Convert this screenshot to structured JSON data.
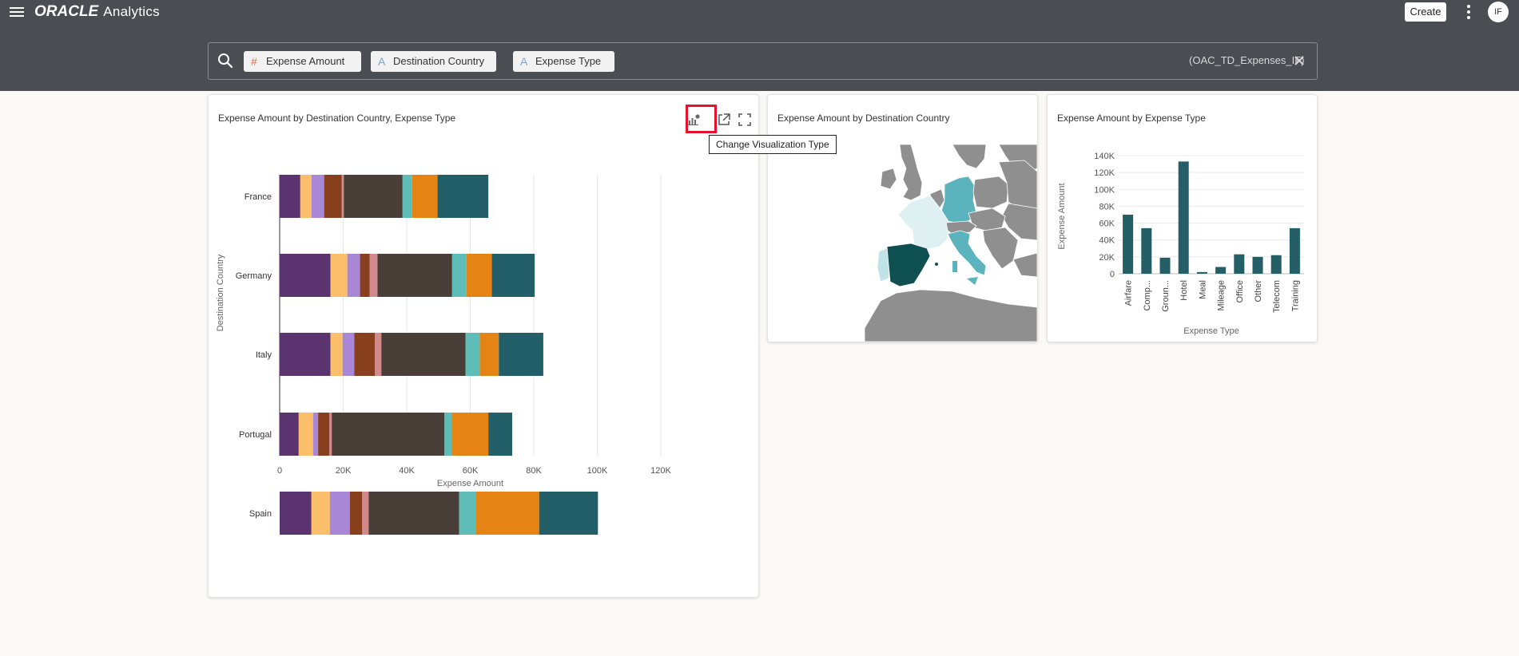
{
  "header": {
    "brand": "ORACLE",
    "product": "Analytics",
    "create_label": "Create",
    "avatar_initials": "IF"
  },
  "search": {
    "pills": [
      {
        "type_symbol": "#",
        "label": "Expense Amount"
      },
      {
        "type_symbol": "A",
        "label": "Destination Country"
      },
      {
        "type_symbol": "A",
        "label": "Expense Type"
      }
    ],
    "dataset": "(OAC_TD_Expenses_IF)"
  },
  "tooltip": "Change Visualization Type",
  "colors": {
    "header_bg": "#4a4e53",
    "highlight": "#e8112d",
    "map_teal_dark": "#0e4f52",
    "map_teal_mid": "#5bb3bd",
    "map_teal_light": "#dff0f3",
    "map_other": "#8f8f8f"
  },
  "chart_data": [
    {
      "type": "bar",
      "orientation": "horizontal",
      "stacked": true,
      "title": "Expense Amount by Destination Country, Expense Type",
      "xlabel": "Expense Amount",
      "ylabel": "Destination Country",
      "xlim": [
        0,
        120000
      ],
      "xticks": [
        "0",
        "20K",
        "40K",
        "60K",
        "80K",
        "100K",
        "120K"
      ],
      "grid": true,
      "categories": [
        "France",
        "Germany",
        "Italy",
        "Portugal",
        "Spain"
      ],
      "series": [
        {
          "color": "#5b336f",
          "values": [
            6500,
            16000,
            16000,
            6000,
            10000
          ]
        },
        {
          "color": "#fbbf6b",
          "values": [
            3500,
            5300,
            3800,
            4500,
            5800
          ]
        },
        {
          "color": "#a887d6",
          "values": [
            4000,
            4000,
            3700,
            1600,
            6300
          ]
        },
        {
          "color": "#873f1e",
          "values": [
            5500,
            3000,
            6500,
            3500,
            3900
          ]
        },
        {
          "color": "#d08a8c",
          "values": [
            700,
            2500,
            2000,
            800,
            2000
          ]
        },
        {
          "color": "#4a3f38",
          "values": [
            18500,
            23500,
            26500,
            35500,
            28500
          ]
        },
        {
          "color": "#5fbdb9",
          "values": [
            3000,
            4500,
            4500,
            2300,
            5200
          ]
        },
        {
          "color": "#e58414",
          "values": [
            8000,
            8000,
            6000,
            11500,
            20000
          ]
        },
        {
          "color": "#225f68",
          "values": [
            16000,
            13500,
            14000,
            7500,
            18500
          ]
        }
      ]
    },
    {
      "type": "map",
      "title": "Expense Amount by Destination Country"
    },
    {
      "type": "bar",
      "title": "Expense Amount by Expense Type",
      "xlabel": "Expense Type",
      "ylabel": "Expense Amount",
      "ylim": [
        0,
        140000
      ],
      "yticks": [
        "0",
        "20K",
        "40K",
        "60K",
        "80K",
        "100K",
        "120K",
        "140K"
      ],
      "grid": true,
      "color": "#245e66",
      "categories": [
        "Airfare",
        "Comp...",
        "Groun...",
        "Hotel",
        "Meal",
        "Mileage",
        "Office",
        "Other",
        "Telecom",
        "Training"
      ],
      "values": [
        70000,
        54000,
        19000,
        133000,
        2000,
        8000,
        23000,
        20000,
        22000,
        54000
      ]
    }
  ]
}
